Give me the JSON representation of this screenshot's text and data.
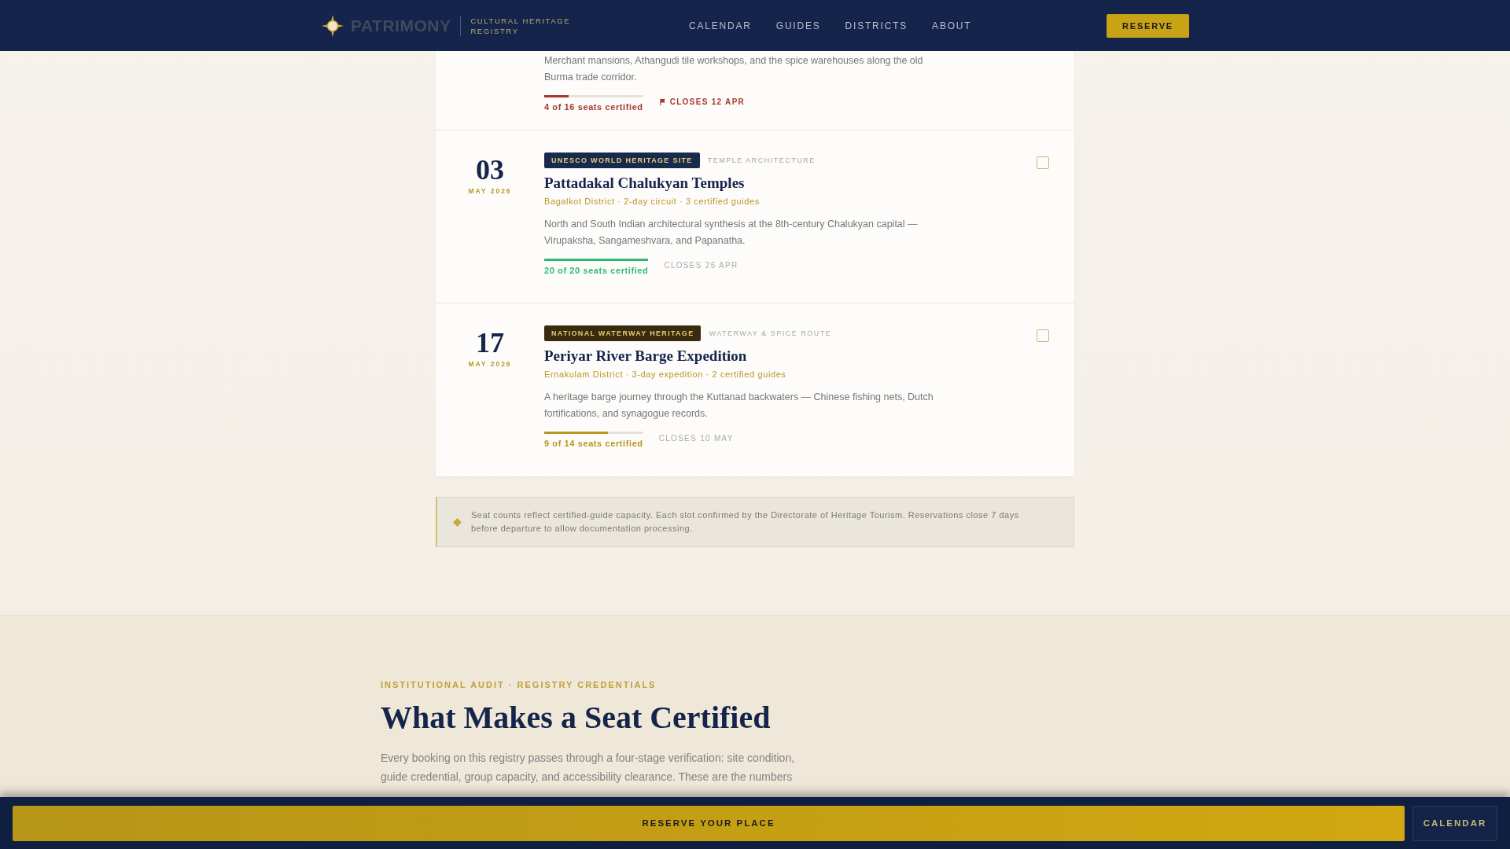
{
  "header": {
    "brand": "PATRIMONY",
    "subtitle": [
      "CULTURAL HERITAGE",
      "REGISTRY"
    ],
    "nav": [
      {
        "label": "CALENDAR",
        "selected": false
      },
      {
        "label": "GUIDES",
        "selected": false
      },
      {
        "label": "DISTRICTS",
        "selected": false
      },
      {
        "label": "ABOUT",
        "selected": false
      }
    ],
    "reserve_button": "RESERVE"
  },
  "expeditions": [
    {
      "description": "Merchant mansions, Athangudi tile workshops, and the spice warehouses along the old Burma trade corridor.",
      "seats": {
        "text": "4 of 16 seats certified",
        "level": 0.25,
        "color": "#a8382a"
      },
      "closes": {
        "text": "CLOSES 12 APR",
        "urgent": true
      }
    },
    {
      "day": "03",
      "month": "MAY 2026",
      "tag": {
        "text": "UNESCO WORLD HERITAGE SITE",
        "color": "#1a2a4e"
      },
      "category": "TEMPLE ARCHITECTURE",
      "title": "Pattadakal Chalukyan Temples",
      "meta": "Bagalkot District · 2-day circuit · 3 certified guides",
      "description": "North and South Indian architectural synthesis at the 8th-century Chalukyan capital — Virupaksha, Sangameshvara, and Papanatha.",
      "seats": {
        "text": "20 of 20 seats certified",
        "level": 1,
        "color": "#2eb872"
      },
      "closes": {
        "text": "CLOSES 26 APR",
        "urgent": false
      },
      "checked": false
    },
    {
      "day": "17",
      "month": "MAY 2026",
      "tag": {
        "text": "NATIONAL WATERWAY HERITAGE",
        "color": "#3a2a0e"
      },
      "category": "WATERWAY & SPICE ROUTE",
      "title": "Periyar River Barge Expedition",
      "meta": "Ernakulam District · 3-day expedition · 2 certified guides",
      "description": "A heritage barge journey through the Kuttanad backwaters — Chinese fishing nets, Dutch fortifications, and synagogue records.",
      "seats": {
        "text": "9 of 14 seats certified",
        "level": 0.643,
        "color": "#b8961f"
      },
      "closes": {
        "text": "CLOSES 10 MAY",
        "urgent": false
      },
      "checked": false
    }
  ],
  "notice": "Seat counts reflect certified-guide capacity. Each slot confirmed by the Directorate of Heritage Tourism. Reservations close 7 days before departure to allow documentation processing.",
  "section": {
    "eyebrow": "INSTITUTIONAL AUDIT · REGISTRY CREDENTIALS",
    "heading": "What Makes a Seat Certified",
    "paragraph": "Every booking on this registry passes through a four-stage verification: site condition, guide credential, group capacity, and accessibility clearance. These are the numbers"
  },
  "bottom_bar": {
    "primary": "RESERVE YOUR PLACE",
    "secondary": "CALENDAR"
  }
}
